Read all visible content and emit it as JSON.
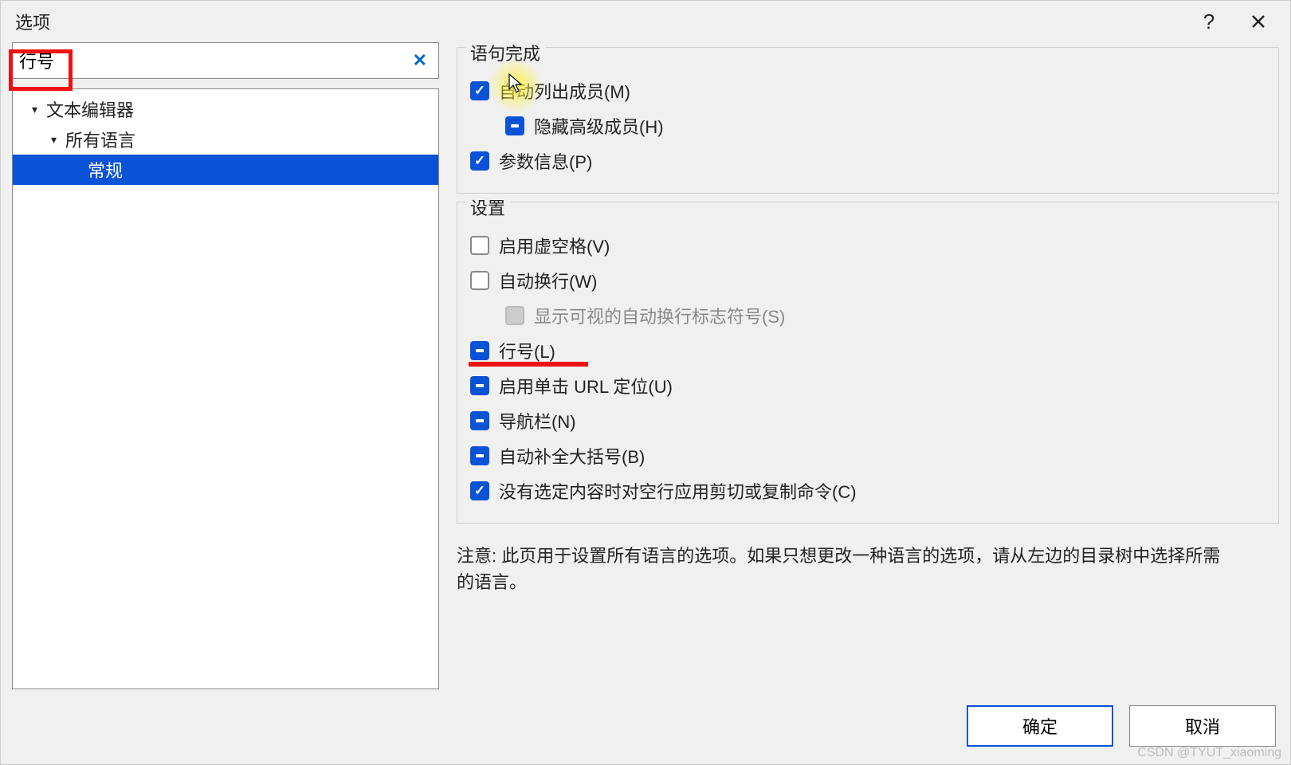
{
  "dialog": {
    "title": "选项",
    "help_tooltip": "?",
    "close_tooltip": "×"
  },
  "search": {
    "value": "行号",
    "clear_label": "✕"
  },
  "tree": {
    "items": [
      {
        "label": "文本编辑器",
        "level": 1,
        "expanded": true
      },
      {
        "label": "所有语言",
        "level": 2,
        "expanded": true
      },
      {
        "label": "常规",
        "level": 3,
        "selected": true
      }
    ]
  },
  "groups": {
    "statement_completion": {
      "title": "语句完成",
      "auto_list_members": "自动列出成员(M)",
      "hide_advanced_members": "隐藏高级成员(H)",
      "parameter_info": "参数信息(P)"
    },
    "settings": {
      "title": "设置",
      "enable_virtual_space": "启用虚空格(V)",
      "word_wrap": "自动换行(W)",
      "show_visual_glyphs": "显示可视的自动换行标志符号(S)",
      "line_numbers": "行号(L)",
      "single_click_url": "启用单击 URL 定位(U)",
      "navigation_bar": "导航栏(N)",
      "auto_brace": "自动补全大括号(B)",
      "cut_copy_blank": "没有选定内容时对空行应用剪切或复制命令(C)"
    }
  },
  "note": "注意: 此页用于设置所有语言的选项。如果只想更改一种语言的选项，请从左边的目录树中选择所需的语言。",
  "buttons": {
    "ok": "确定",
    "cancel": "取消"
  },
  "watermark": "CSDN @TYUT_xiaoming"
}
